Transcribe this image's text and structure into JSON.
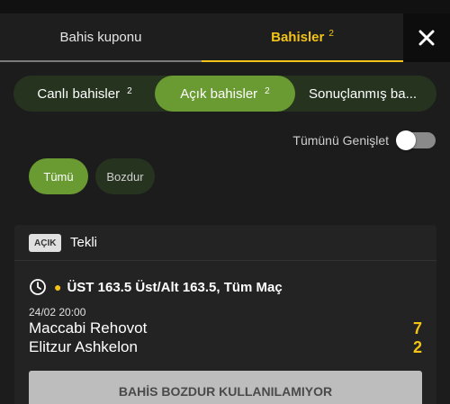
{
  "tabs": [
    {
      "label": "Bahis kuponu",
      "count": ""
    },
    {
      "label": "Bahisler",
      "count": "2"
    }
  ],
  "segments": [
    {
      "label": "Canlı bahisler",
      "count": "2"
    },
    {
      "label": "Açık bahisler",
      "count": "2"
    },
    {
      "label": "Sonuçlanmış ba..."
    }
  ],
  "expand_all": {
    "label": "Tümünü Genişlet",
    "enabled": false
  },
  "filters": [
    {
      "label": "Tümü",
      "selected": true
    },
    {
      "label": "Bozdur",
      "selected": false
    }
  ],
  "bet": {
    "status_badge": "AÇIK",
    "type": "Tekli",
    "market": "ÜST 163.5 Üst/Alt 163.5, Tüm Maç",
    "datetime": "24/02 20:00",
    "home": {
      "name": "Maccabi Rehovot",
      "score": "7"
    },
    "away": {
      "name": "Elitzur Ashkelon",
      "score": "2"
    },
    "cashout_label": "BAHİS BOZDUR KULLANILAMIYOR"
  },
  "colors": {
    "accent": "#f3c316",
    "green": "#6a9a32",
    "background": "#1c1c1c"
  },
  "icons": {
    "close": "close-icon",
    "clock": "clock-icon"
  }
}
